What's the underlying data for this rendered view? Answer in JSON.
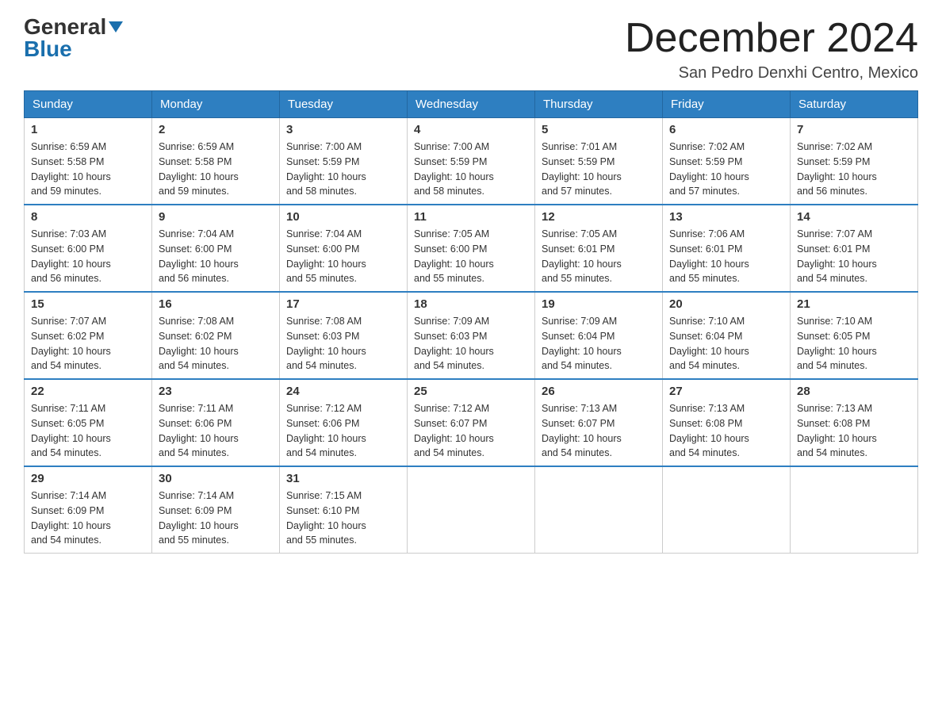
{
  "header": {
    "logo_general": "General",
    "logo_blue": "Blue",
    "month_title": "December 2024",
    "location": "San Pedro Denxhi Centro, Mexico"
  },
  "days_of_week": [
    "Sunday",
    "Monday",
    "Tuesday",
    "Wednesday",
    "Thursday",
    "Friday",
    "Saturday"
  ],
  "weeks": [
    [
      {
        "day": "1",
        "sunrise": "6:59 AM",
        "sunset": "5:58 PM",
        "daylight": "10 hours and 59 minutes."
      },
      {
        "day": "2",
        "sunrise": "6:59 AM",
        "sunset": "5:58 PM",
        "daylight": "10 hours and 59 minutes."
      },
      {
        "day": "3",
        "sunrise": "7:00 AM",
        "sunset": "5:59 PM",
        "daylight": "10 hours and 58 minutes."
      },
      {
        "day": "4",
        "sunrise": "7:00 AM",
        "sunset": "5:59 PM",
        "daylight": "10 hours and 58 minutes."
      },
      {
        "day": "5",
        "sunrise": "7:01 AM",
        "sunset": "5:59 PM",
        "daylight": "10 hours and 57 minutes."
      },
      {
        "day": "6",
        "sunrise": "7:02 AM",
        "sunset": "5:59 PM",
        "daylight": "10 hours and 57 minutes."
      },
      {
        "day": "7",
        "sunrise": "7:02 AM",
        "sunset": "5:59 PM",
        "daylight": "10 hours and 56 minutes."
      }
    ],
    [
      {
        "day": "8",
        "sunrise": "7:03 AM",
        "sunset": "6:00 PM",
        "daylight": "10 hours and 56 minutes."
      },
      {
        "day": "9",
        "sunrise": "7:04 AM",
        "sunset": "6:00 PM",
        "daylight": "10 hours and 56 minutes."
      },
      {
        "day": "10",
        "sunrise": "7:04 AM",
        "sunset": "6:00 PM",
        "daylight": "10 hours and 55 minutes."
      },
      {
        "day": "11",
        "sunrise": "7:05 AM",
        "sunset": "6:00 PM",
        "daylight": "10 hours and 55 minutes."
      },
      {
        "day": "12",
        "sunrise": "7:05 AM",
        "sunset": "6:01 PM",
        "daylight": "10 hours and 55 minutes."
      },
      {
        "day": "13",
        "sunrise": "7:06 AM",
        "sunset": "6:01 PM",
        "daylight": "10 hours and 55 minutes."
      },
      {
        "day": "14",
        "sunrise": "7:07 AM",
        "sunset": "6:01 PM",
        "daylight": "10 hours and 54 minutes."
      }
    ],
    [
      {
        "day": "15",
        "sunrise": "7:07 AM",
        "sunset": "6:02 PM",
        "daylight": "10 hours and 54 minutes."
      },
      {
        "day": "16",
        "sunrise": "7:08 AM",
        "sunset": "6:02 PM",
        "daylight": "10 hours and 54 minutes."
      },
      {
        "day": "17",
        "sunrise": "7:08 AM",
        "sunset": "6:03 PM",
        "daylight": "10 hours and 54 minutes."
      },
      {
        "day": "18",
        "sunrise": "7:09 AM",
        "sunset": "6:03 PM",
        "daylight": "10 hours and 54 minutes."
      },
      {
        "day": "19",
        "sunrise": "7:09 AM",
        "sunset": "6:04 PM",
        "daylight": "10 hours and 54 minutes."
      },
      {
        "day": "20",
        "sunrise": "7:10 AM",
        "sunset": "6:04 PM",
        "daylight": "10 hours and 54 minutes."
      },
      {
        "day": "21",
        "sunrise": "7:10 AM",
        "sunset": "6:05 PM",
        "daylight": "10 hours and 54 minutes."
      }
    ],
    [
      {
        "day": "22",
        "sunrise": "7:11 AM",
        "sunset": "6:05 PM",
        "daylight": "10 hours and 54 minutes."
      },
      {
        "day": "23",
        "sunrise": "7:11 AM",
        "sunset": "6:06 PM",
        "daylight": "10 hours and 54 minutes."
      },
      {
        "day": "24",
        "sunrise": "7:12 AM",
        "sunset": "6:06 PM",
        "daylight": "10 hours and 54 minutes."
      },
      {
        "day": "25",
        "sunrise": "7:12 AM",
        "sunset": "6:07 PM",
        "daylight": "10 hours and 54 minutes."
      },
      {
        "day": "26",
        "sunrise": "7:13 AM",
        "sunset": "6:07 PM",
        "daylight": "10 hours and 54 minutes."
      },
      {
        "day": "27",
        "sunrise": "7:13 AM",
        "sunset": "6:08 PM",
        "daylight": "10 hours and 54 minutes."
      },
      {
        "day": "28",
        "sunrise": "7:13 AM",
        "sunset": "6:08 PM",
        "daylight": "10 hours and 54 minutes."
      }
    ],
    [
      {
        "day": "29",
        "sunrise": "7:14 AM",
        "sunset": "6:09 PM",
        "daylight": "10 hours and 54 minutes."
      },
      {
        "day": "30",
        "sunrise": "7:14 AM",
        "sunset": "6:09 PM",
        "daylight": "10 hours and 55 minutes."
      },
      {
        "day": "31",
        "sunrise": "7:15 AM",
        "sunset": "6:10 PM",
        "daylight": "10 hours and 55 minutes."
      },
      null,
      null,
      null,
      null
    ]
  ],
  "labels": {
    "sunrise_prefix": "Sunrise: ",
    "sunset_prefix": "Sunset: ",
    "daylight_prefix": "Daylight: "
  }
}
